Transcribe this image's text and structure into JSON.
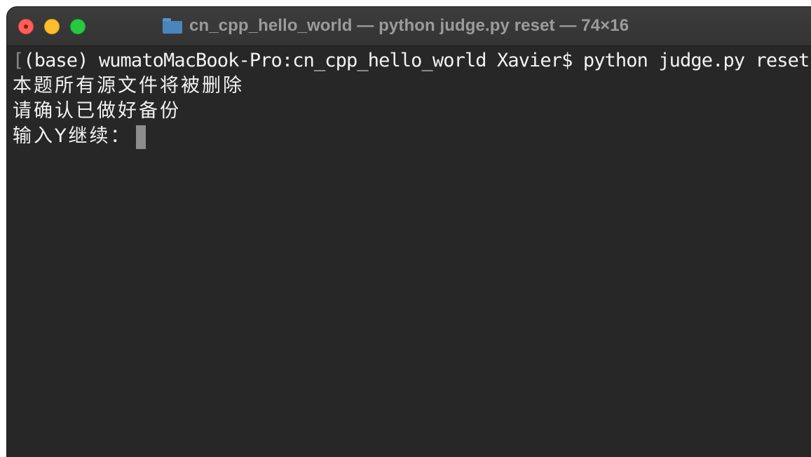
{
  "window": {
    "title": "cn_cpp_hello_world — python judge.py reset — 74×16",
    "icon": "folder-icon"
  },
  "terminal": {
    "lines": [
      "(base) wumatoMacBook-Pro:cn_cpp_hello_world Xavier$ python judge.py reset",
      "本题所有源文件将被删除",
      "请确认已做好备份",
      "输入Y继续："
    ],
    "mark_open": "[",
    "mark_close": "]"
  },
  "colors": {
    "terminal_background": "#272727",
    "titlebar_background": "#383838",
    "text": "#f2f2f2",
    "cursor": "#8d8d8d",
    "close": "#fe5f57",
    "minimize": "#febc2e",
    "zoom": "#28c840"
  }
}
